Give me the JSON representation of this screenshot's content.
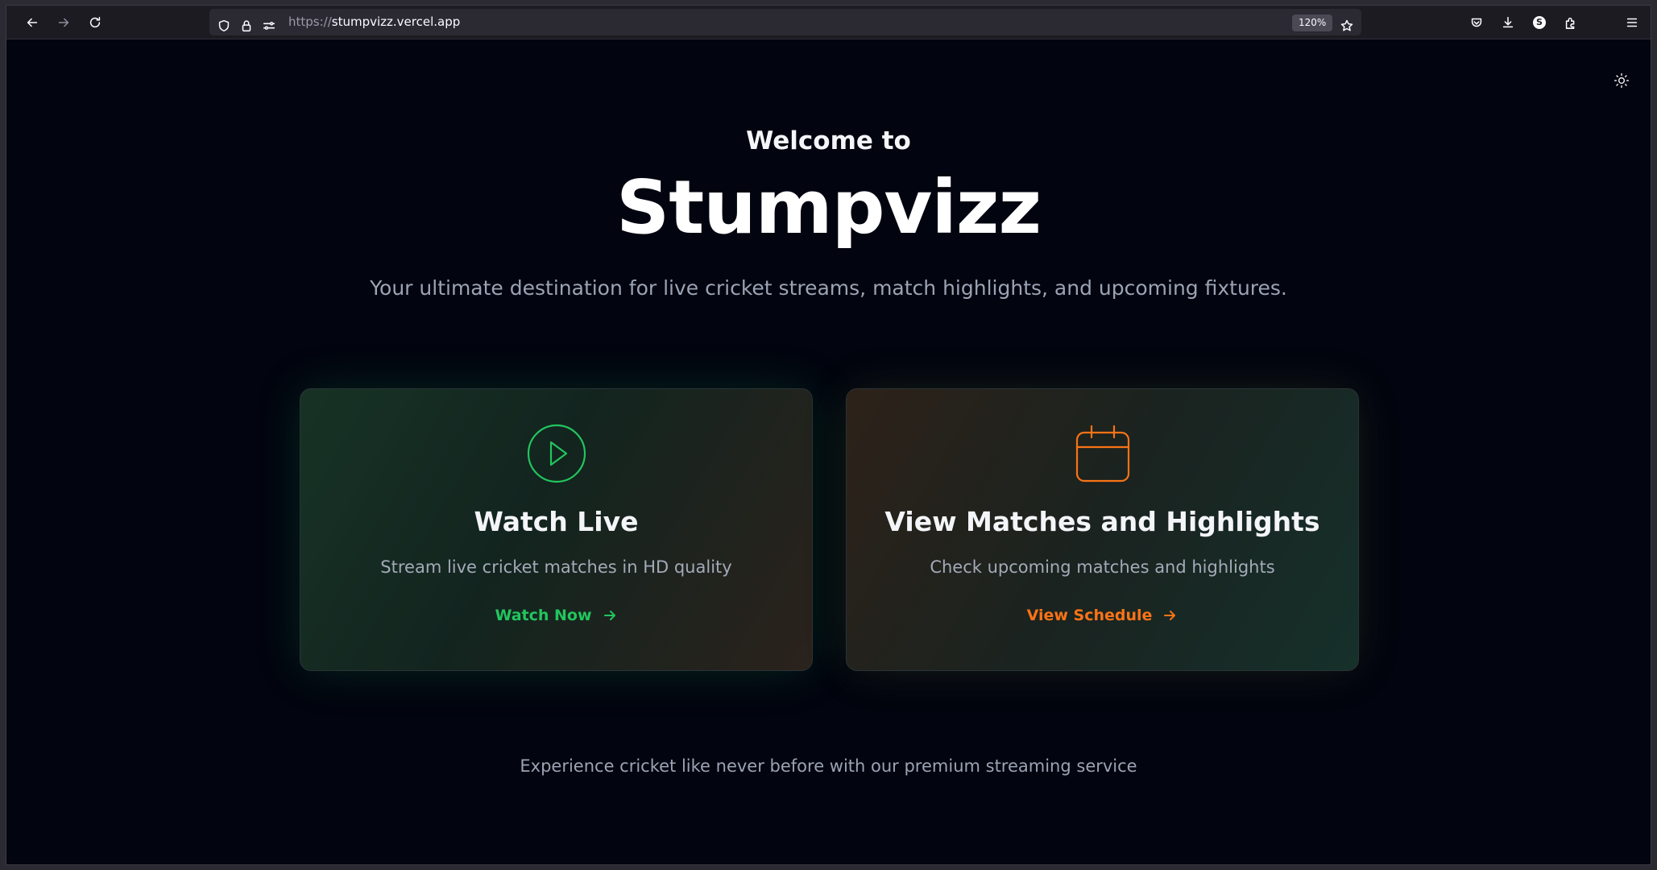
{
  "browser": {
    "url_scheme": "https://",
    "url_host": "stumpvizz.vercel.app",
    "zoom": "120%",
    "profile_initial": "S"
  },
  "hero": {
    "welcome": "Welcome to",
    "brand": "Stumpvizz",
    "tagline": "Your ultimate destination for live cricket streams, match highlights, and upcoming fixtures."
  },
  "cards": [
    {
      "title": "Watch Live",
      "description": "Stream live cricket matches in HD quality",
      "link": "Watch Now",
      "icon": "play-circle-icon",
      "accent": "#22c55e"
    },
    {
      "title": "View Matches and Highlights",
      "description": "Check upcoming matches and highlights",
      "link": "View Schedule",
      "icon": "calendar-icon",
      "accent": "#f97316"
    }
  ],
  "footer": {
    "text": "Experience cricket like never before with our premium streaming service"
  },
  "theme": {
    "background": "#02040f",
    "toggle_icon": "sun-icon"
  }
}
